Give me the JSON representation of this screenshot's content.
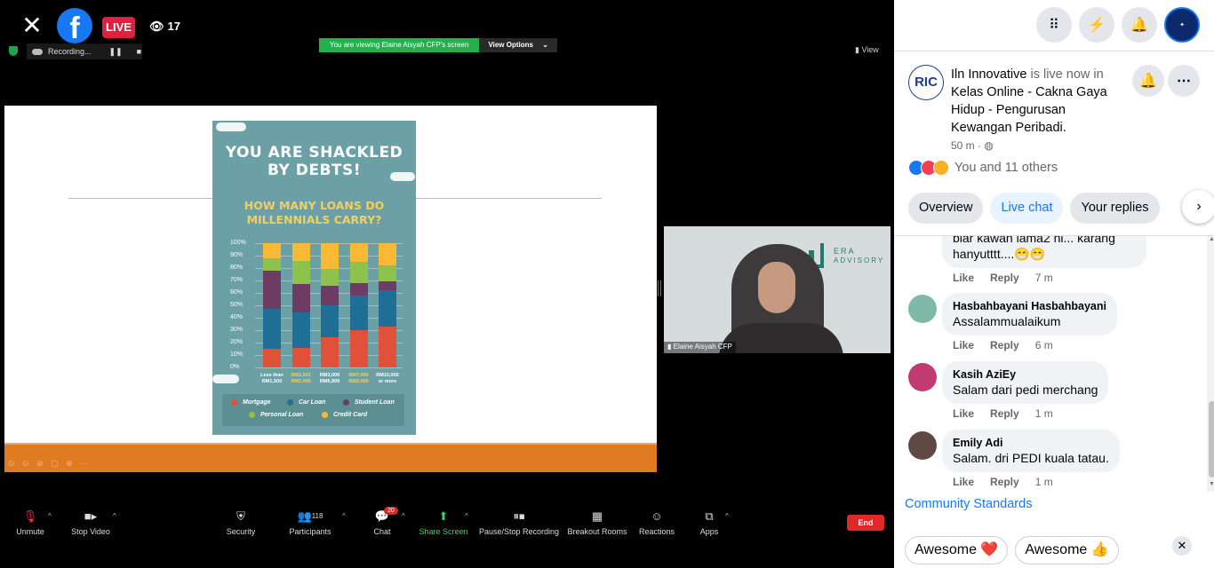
{
  "facebook": {
    "close_icon": "close-icon",
    "logo_letter": "f",
    "live_label": "LIVE",
    "viewer_count": "17"
  },
  "zoom": {
    "share_banner": "You are viewing Elaine Aisyah CFP's screen",
    "view_options": "View Options",
    "recording_label": "Recording...",
    "view_label": "View",
    "camera_name": "Elaine Aisyah CFP",
    "brand_logo": {
      "line1": "ERA",
      "line2": "ADVISORY"
    },
    "slide": {
      "title": "YOU ARE SHACKLED BY DEBTS!",
      "subtitle": "HOW MANY LOANS DO MILLENNIALS CARRY?",
      "colors": {
        "background": "#6aa0a6",
        "title": "#ffffff",
        "subtitle": "#f6cf5a",
        "footer": "#e07b22"
      }
    },
    "toolbar": {
      "unmute": "Unmute",
      "stop_video": "Stop Video",
      "security": "Security",
      "participants": "Participants",
      "participants_count": "118",
      "chat": "Chat",
      "chat_badge": "20",
      "share_screen": "Share Screen",
      "pause_recording": "Pause/Stop Recording",
      "breakout_rooms": "Breakout Rooms",
      "reactions": "Reactions",
      "apps": "Apps",
      "end": "End"
    }
  },
  "chart_data": {
    "type": "bar",
    "title": "HOW MANY LOANS DO MILLENNIALS CARRY?",
    "stacked": true,
    "ylim": [
      0,
      100
    ],
    "yticks": [
      "100%",
      "90%",
      "80%",
      "70%",
      "60%",
      "50%",
      "40%",
      "30%",
      "20%",
      "10%",
      "0%"
    ],
    "categories": [
      {
        "line1": "Less than",
        "line2": "RM1,500"
      },
      {
        "line1": "RM1,501",
        "line2": "RM2,999"
      },
      {
        "line1": "RM3,000",
        "line2": "RM6,999"
      },
      {
        "line1": "RM7,000",
        "line2": "RM9,999"
      },
      {
        "line1": "RM10,000",
        "line2": "or more"
      }
    ],
    "category_colors": [
      "#ffffff",
      "#f6cf5a",
      "#ffffff",
      "#f6cf5a",
      "#ffffff"
    ],
    "series": [
      {
        "name": "Mortgage",
        "color": "#e0513a",
        "values": [
          15,
          16,
          24,
          30,
          33
        ]
      },
      {
        "name": "Car Loan",
        "color": "#1f6e96",
        "values": [
          32,
          28,
          26,
          28,
          29
        ]
      },
      {
        "name": "Student Loan",
        "color": "#6d3b63",
        "values": [
          31,
          23,
          16,
          10,
          7
        ]
      },
      {
        "name": "Personal Loan",
        "color": "#8dc24f",
        "values": [
          10,
          19,
          13,
          17,
          13
        ]
      },
      {
        "name": "Credit Card",
        "color": "#f9b935",
        "values": [
          12,
          14,
          21,
          15,
          18
        ]
      }
    ]
  },
  "panel": {
    "top_icons": [
      "menu-grid-icon",
      "messenger-icon",
      "notifications-icon",
      "profile-avatar"
    ],
    "post": {
      "avatar_text": "RIC",
      "author": "Iln Innovative",
      "is_live_text": " is live now in",
      "group": "Kelas Online - Cakna Gaya Hidup - Pengurusan Kewangan Peribadi",
      "period": ".",
      "time": "50 m · ",
      "reactions_text": "You and 11 others"
    },
    "tabs": [
      "Overview",
      "Live chat",
      "Your replies"
    ],
    "comments": [
      {
        "name": "",
        "text": "biar kawan lama2 ni... karang hanyutttt....😁😁",
        "like": "Like",
        "reply": "Reply",
        "time": "7 m"
      },
      {
        "name": "Hasbahbayani Hasbahbayani",
        "text": "Assalammualaikum",
        "like": "Like",
        "reply": "Reply",
        "time": "6 m"
      },
      {
        "name": "Kasih AziEy",
        "text": "Salam dari pedi merchang",
        "like": "Like",
        "reply": "Reply",
        "time": "1 m"
      },
      {
        "name": "Emily Adi",
        "text": "Salam. dri PEDI kuala tatau.",
        "like": "Like",
        "reply": "Reply",
        "time": "1 m"
      }
    ],
    "community_standards": "Community Standards",
    "quick_replies": [
      "Awesome ❤️",
      "Awesome 👍"
    ],
    "colors": {
      "accent": "#1877f2",
      "live": "#e41e3f"
    }
  }
}
